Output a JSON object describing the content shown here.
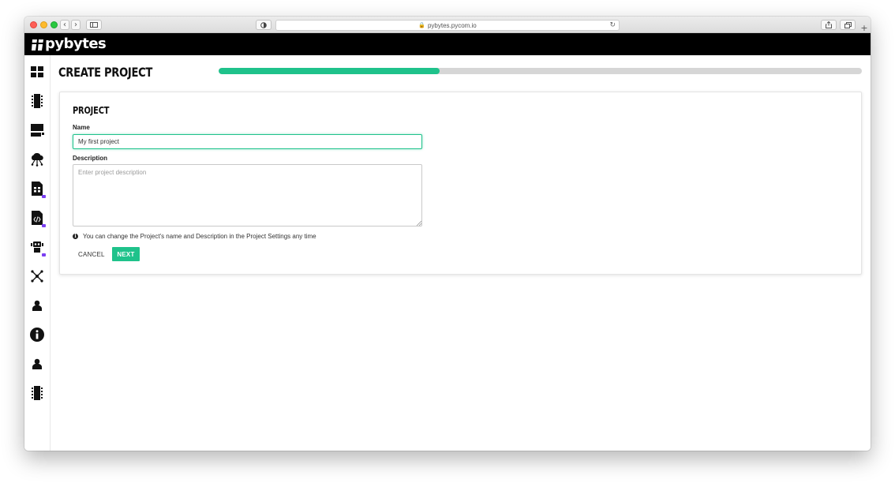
{
  "browser": {
    "url": "pybytes.pycom.io",
    "controls": {
      "back": "‹",
      "forward": "›"
    }
  },
  "app": {
    "brand": "pybytes"
  },
  "sidebar": {
    "items": [
      {
        "icon": "dashboard-icon"
      },
      {
        "icon": "device-chip-icon"
      },
      {
        "icon": "storage-icon"
      },
      {
        "icon": "cloud-network-icon"
      },
      {
        "icon": "sim-card-icon"
      },
      {
        "icon": "code-file-icon"
      },
      {
        "icon": "robot-icon"
      },
      {
        "icon": "network-nodes-icon"
      },
      {
        "icon": "user-icon"
      },
      {
        "icon": "info-icon"
      },
      {
        "icon": "user-icon"
      },
      {
        "icon": "device-chip-icon"
      }
    ]
  },
  "page": {
    "title": "Create Project",
    "progress_fraction": 0.343
  },
  "form": {
    "section_title": "Project",
    "name_label": "Name",
    "name_value": "My first project",
    "description_label": "Description",
    "description_placeholder": "Enter project description",
    "hint": "You can change the Project's name and Description in the Project Settings any time",
    "cancel_label": "CANCEL",
    "next_label": "NEXT"
  },
  "colors": {
    "accent": "#1fc28b",
    "badge": "#7b3ff2",
    "brand_bar": "#000000"
  }
}
